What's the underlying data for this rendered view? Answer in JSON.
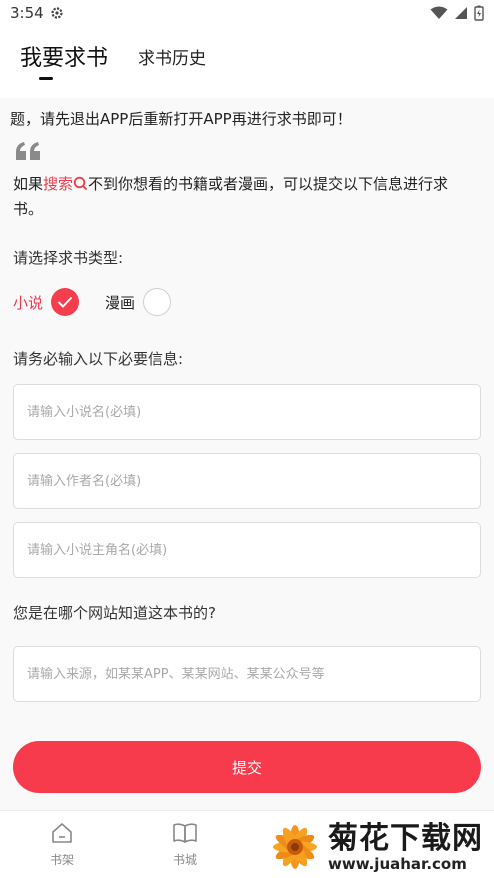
{
  "status_bar": {
    "time": "3:54"
  },
  "tabs": [
    {
      "label": "我要求书"
    },
    {
      "label": "求书历史"
    }
  ],
  "notice": "题，请先退出APP后重新打开APP再进行求书即可！",
  "intro": {
    "prefix": "如果",
    "search_word": "搜索",
    "suffix": "不到你想看的书籍或者漫画，可以提交以下信息进行求书。"
  },
  "type_label": "请选择求书类型:",
  "book_types": [
    {
      "label": "小说",
      "selected": true
    },
    {
      "label": "漫画",
      "selected": false
    }
  ],
  "required_label": "请务必输入以下必要信息:",
  "fields": {
    "title_placeholder": "请输入小说名(必填)",
    "author_placeholder": "请输入作者名(必填)",
    "protagonist_placeholder": "请输入小说主角名(必填)",
    "source_placeholder": "请输入来源，如某某APP、某某网站、某某公众号等"
  },
  "source_label": "您是在哪个网站知道这本书的?",
  "submit_label": "提交",
  "bottom_nav": [
    {
      "label": "书架",
      "icon": "bookshelf-icon"
    },
    {
      "label": "书城",
      "icon": "book-icon"
    }
  ],
  "watermark": {
    "name": "菊花下载网",
    "url": "www.juahar.com"
  },
  "colors": {
    "accent": "#f73b4c",
    "accent_text": "#ef3a4a"
  }
}
